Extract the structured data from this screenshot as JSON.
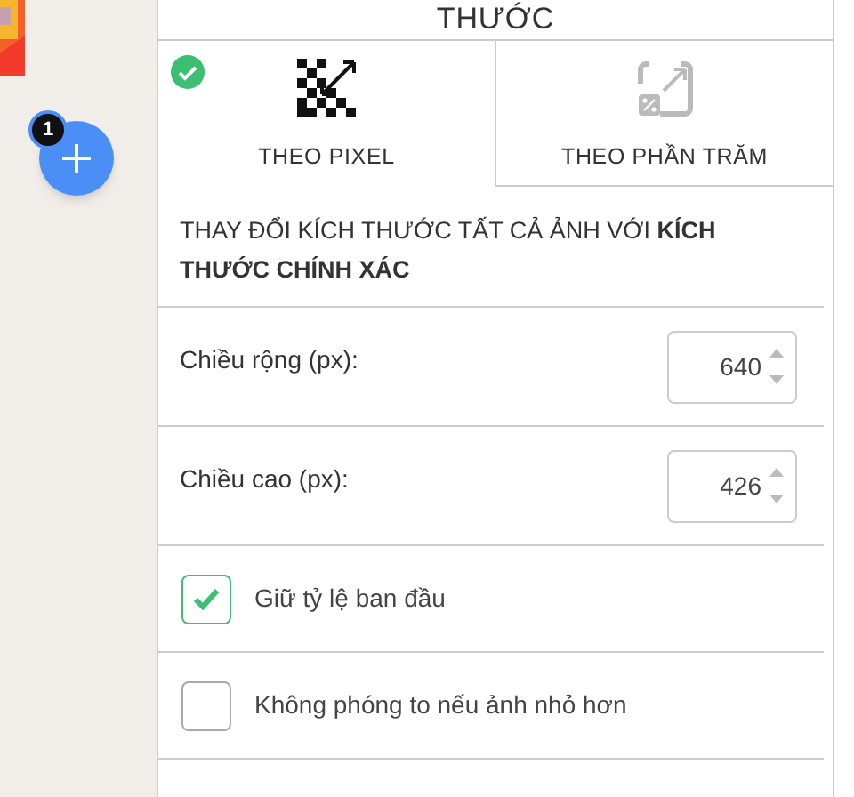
{
  "fab": {
    "badge": "1"
  },
  "panel": {
    "title": "THƯỚC",
    "tabs": [
      {
        "label": "THEO PIXEL",
        "selected": true,
        "kind": "pixel"
      },
      {
        "label": "THEO PHẦN TRĂM",
        "selected": false,
        "kind": "percent"
      }
    ],
    "description": "THAY ĐỔI KÍCH THƯỚC TẤT CẢ ẢNH VỚI **KÍCH THƯỚC CHÍNH XÁC**",
    "fields": [
      {
        "label": "Chiều rộng (px):",
        "value": "640"
      },
      {
        "label": "Chiều cao (px):",
        "value": "426"
      }
    ],
    "options": [
      {
        "label": "Giữ tỷ lệ ban đầu",
        "checked": true
      },
      {
        "label": "Không phóng to nếu ảnh nhỏ hơn",
        "checked": false
      }
    ]
  }
}
